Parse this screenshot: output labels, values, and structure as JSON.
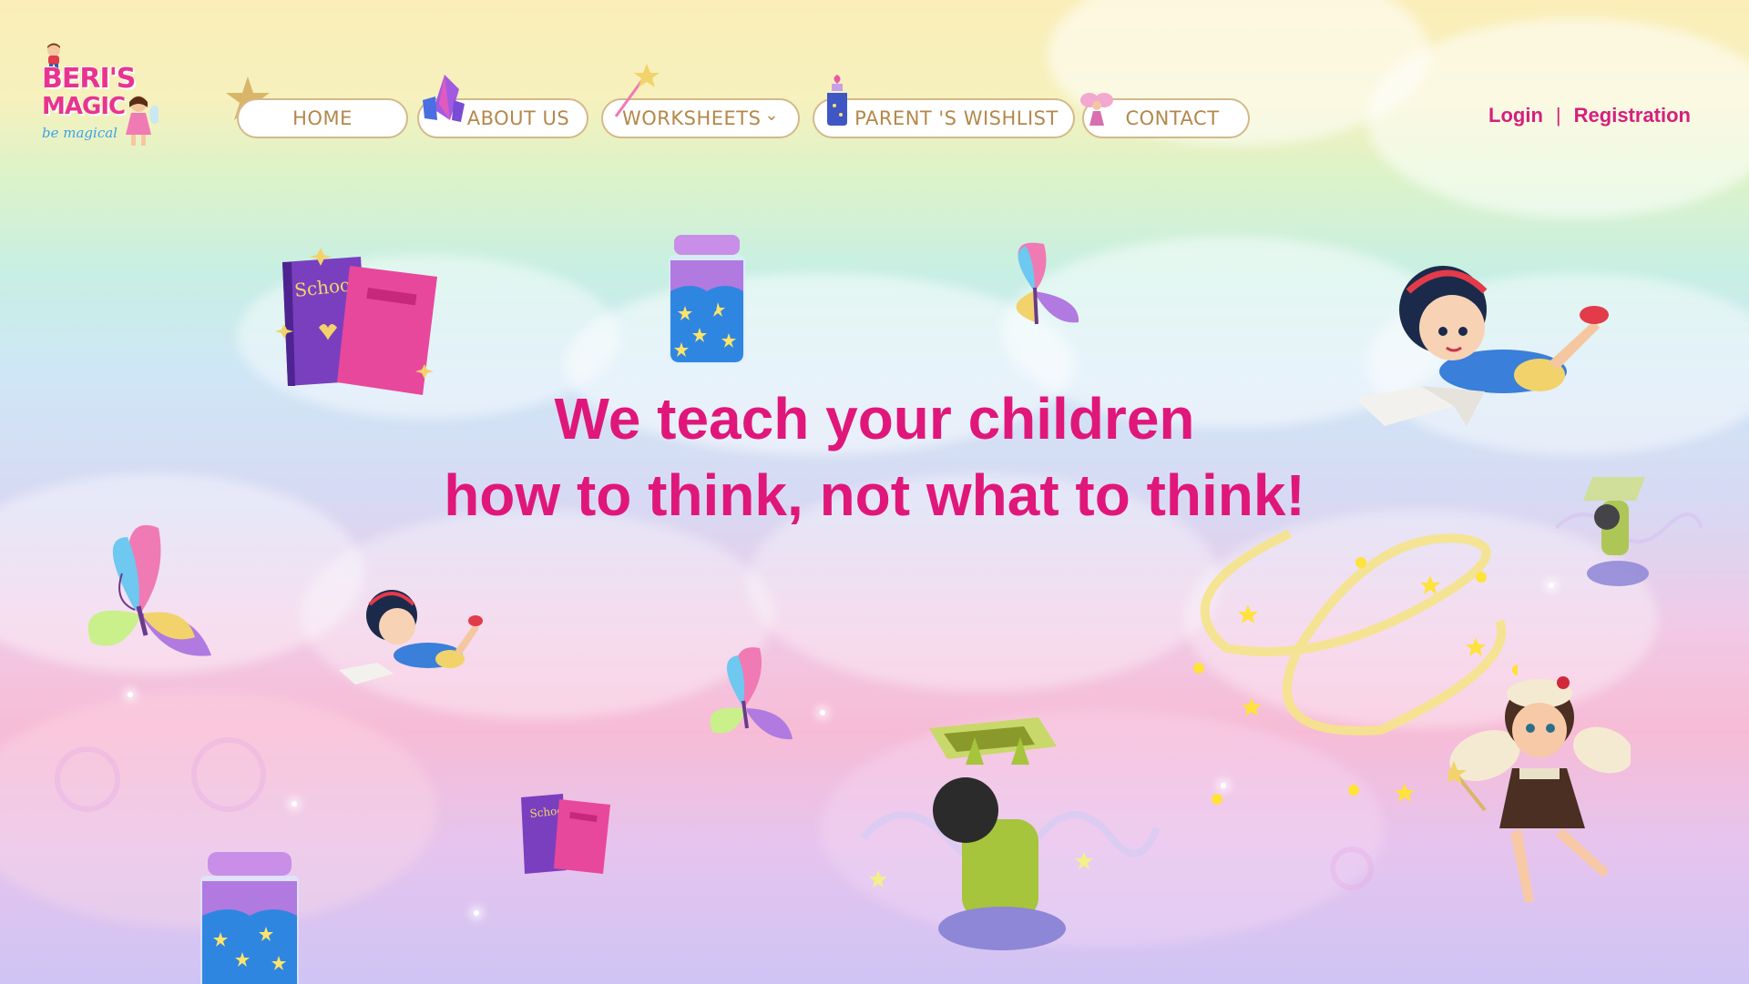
{
  "brand": {
    "name_line1": "BERI'S",
    "name_line2": "MAGIC",
    "tagline": "be magical"
  },
  "nav": {
    "items": [
      {
        "label": "HOME",
        "icon": "star-icon"
      },
      {
        "label": "ABOUT US",
        "icon": "crystal-icon"
      },
      {
        "label": "WORKSHEETS",
        "icon": "magic-wand-icon",
        "has_dropdown": true
      },
      {
        "label": "PARENT 'S WISHLIST",
        "icon": "potion-jar-icon"
      },
      {
        "label": "CONTACT",
        "icon": "fairy-icon"
      }
    ],
    "dropdown_glyph": "⌄"
  },
  "auth": {
    "login": "Login",
    "separator": "|",
    "register": "Registration"
  },
  "hero": {
    "line1": "We teach your children",
    "line2": "how to think, not what to think!"
  },
  "book_label": "School",
  "colors": {
    "headline": "#e0177a",
    "auth_link": "#d51f7c",
    "nav_text": "#b3884a",
    "nav_border": "#d4b98a"
  }
}
